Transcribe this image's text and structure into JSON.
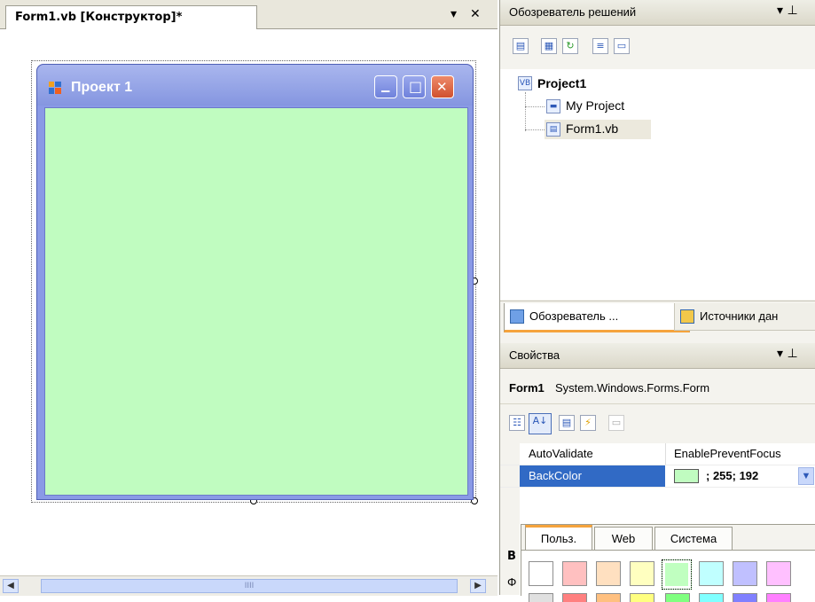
{
  "designer": {
    "tab_title": "Form1.vb [Конструктор]*",
    "pin_glyph": "▾",
    "close_glyph": "✕",
    "form": {
      "title": "Проект 1",
      "back_color": "#c0fcc0",
      "minimize_glyph": "▁",
      "maximize_glyph": "□",
      "close_glyph": "✕"
    },
    "hscroll": {
      "left_glyph": "◀",
      "right_glyph": "▶",
      "grip": "IIII"
    }
  },
  "solution_explorer": {
    "title": "Обозреватель решений",
    "pin_glyph": "▾ ⊥",
    "tree": {
      "root": "Project1",
      "children": [
        "My Project",
        "Form1.vb"
      ]
    },
    "bottom_tabs": [
      "Обозреватель ...",
      "Источники дан"
    ]
  },
  "properties": {
    "title": "Свойства",
    "pin_glyph": "▾ ⊥",
    "object_name": "Form1",
    "object_type": "System.Windows.Forms.Form",
    "rows": [
      {
        "name": "AutoValidate",
        "value": "EnablePreventFocus"
      },
      {
        "name": "BackColor",
        "value": "; 255; 192",
        "swatch": "#c0fcc0"
      }
    ],
    "side_letters": [
      "В",
      "Ф"
    ],
    "color_picker": {
      "tabs": [
        "Польз.",
        "Web",
        "Система"
      ],
      "swatches_row1": [
        "#ffffff",
        "#ffc0c0",
        "#ffe0c0",
        "#ffffc0",
        "#c0ffc0",
        "#c0ffff",
        "#c0c0ff",
        "#ffc0ff"
      ],
      "swatches_row2": [
        "#e0e0e0",
        "#ff8080",
        "#ffc080",
        "#ffff80",
        "#80ff80",
        "#80ffff",
        "#8080ff",
        "#ff80ff"
      ]
    }
  }
}
